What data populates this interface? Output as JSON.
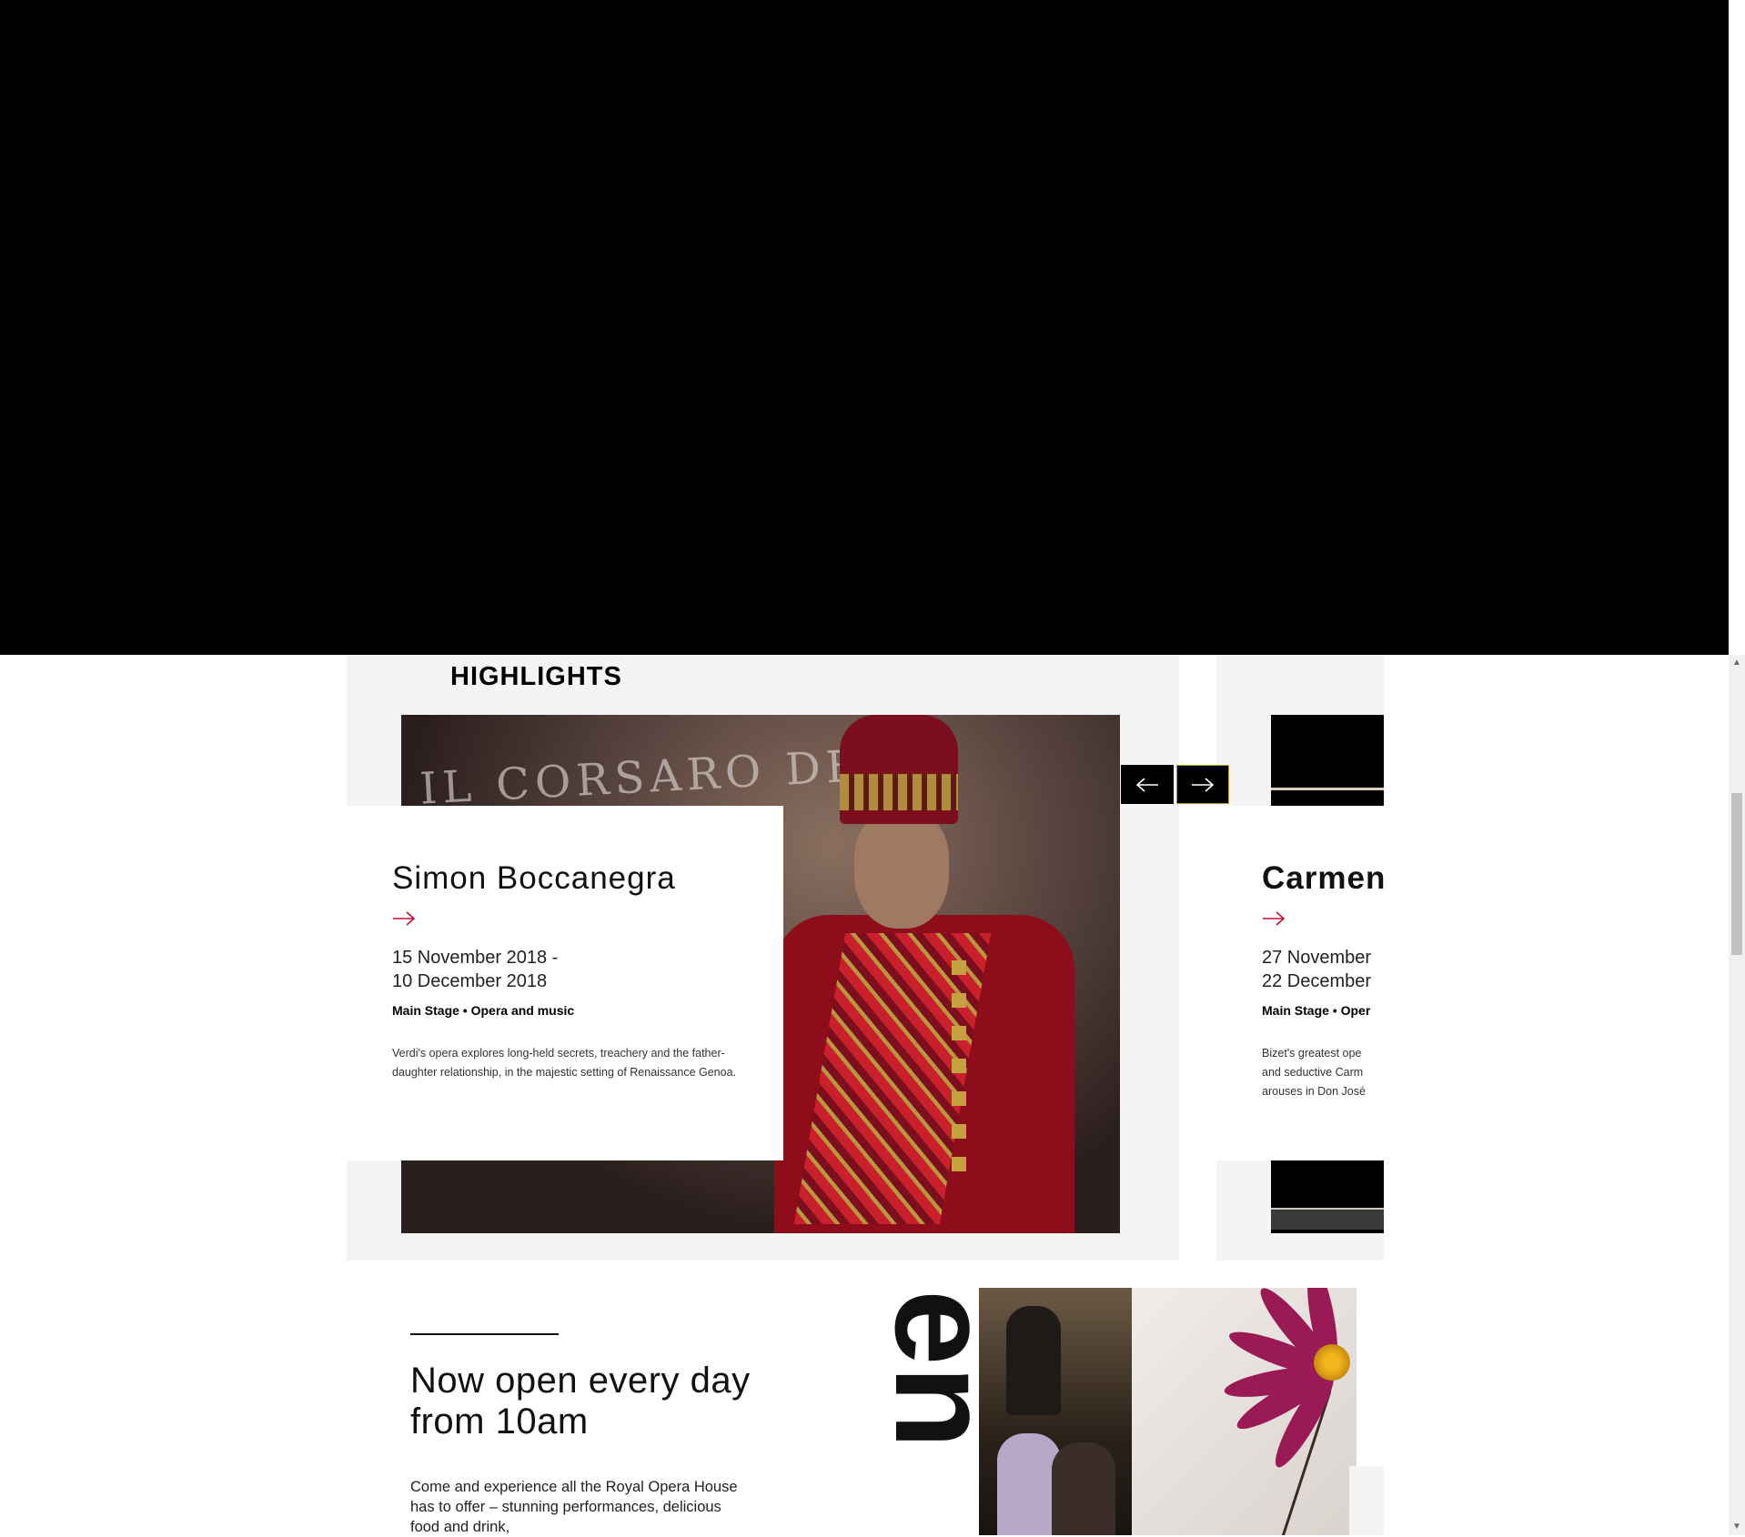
{
  "section": {
    "title": "HIGHLIGHTS"
  },
  "carousel": {
    "prev_label": "←",
    "next_label": "→",
    "slides": [
      {
        "title": "Simon Boccanegra",
        "image_text": "IL CORSARO DEL",
        "date_start": "15 November 2018 -",
        "date_end": "10 December 2018",
        "venue": "Main Stage",
        "category": "Opera and music",
        "description": "Verdi's opera explores long-held secrets, treachery and the father-daughter relationship, in the majestic setting of Renaissance Genoa."
      },
      {
        "title": "Carmen",
        "date_start": "27 November",
        "date_end": "22 December",
        "venue": "Main Stage",
        "category": "Oper",
        "desc_line1": "Bizet's greatest ope",
        "desc_line2": "and seductive Carm",
        "desc_line3": "arouses in Don José"
      }
    ]
  },
  "promo": {
    "heading": "Now open every day from 10am",
    "body": "Come and experience all the Royal Opera House has to offer – stunning performances, delicious food and drink,",
    "vertical_word": "en"
  },
  "scrollbar": {
    "up": "▲",
    "down": "▼"
  },
  "colors": {
    "accent": "#c8102e",
    "gold_border": "#b8942f",
    "panel_bg": "#f4f4f4"
  }
}
